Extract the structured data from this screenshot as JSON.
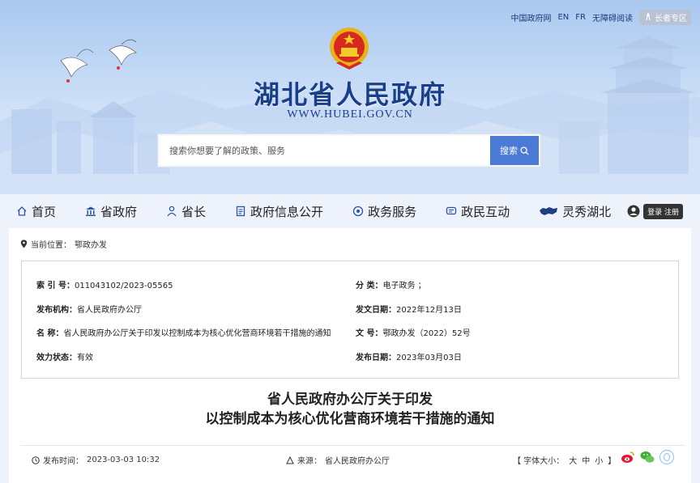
{
  "toplinks": {
    "gov_link": "中国政府网",
    "en": "EN",
    "fr": "FR",
    "accessible": "无障碍阅读",
    "elder": "长者专区"
  },
  "header": {
    "title": "湖北省人民政府",
    "url": "WWW.HUBEI.GOV.CN"
  },
  "search": {
    "placeholder": "搜索你想要了解的政策、服务",
    "button": "搜索"
  },
  "nav": {
    "items": [
      {
        "label": "首页",
        "icon": "home-icon"
      },
      {
        "label": "省政府",
        "icon": "building-icon"
      },
      {
        "label": "省长",
        "icon": "person-icon"
      },
      {
        "label": "政府信息公开",
        "icon": "document-icon"
      },
      {
        "label": "政务服务",
        "icon": "service-icon"
      },
      {
        "label": "政民互动",
        "icon": "chat-icon"
      },
      {
        "label": "灵秀湖北",
        "icon": "map-icon"
      }
    ],
    "login": "登录 注册"
  },
  "breadcrumb": {
    "label": "当前位置：",
    "current": "鄂政办发"
  },
  "meta": {
    "index_no_label": "索 引 号：",
    "index_no": "011043102/2023-05565",
    "category_label": "分    类：",
    "category": "电子政务   ；",
    "publisher_label": "发布机构：",
    "publisher": "省人民政府办公厅",
    "issue_date_label": "发文日期：",
    "issue_date": "2022年12月13日",
    "name_label": "名    称：",
    "name": "省人民政府办公厅关于印发以控制成本为核心优化营商环境若干措施的通知",
    "doc_no_label": "文    号：",
    "doc_no": "鄂政办发（2022）52号",
    "status_label": "效力状态：",
    "status": "有效",
    "release_date_label": "发布日期：",
    "release_date": "2023年03月03日"
  },
  "document": {
    "title_line1": "省人民政府办公厅关于印发",
    "title_line2": "以控制成本为核心优化营商环境若干措施的通知"
  },
  "info": {
    "pub_time_label": "发布时间：",
    "pub_time": "2023-03-03 10:32",
    "source_label": "来源：",
    "source": "省人民政府办公厅",
    "font_size_label": "【 字体大小：",
    "font_large": "大",
    "font_medium": "中",
    "font_small": "小",
    "font_close": "】"
  },
  "colors": {
    "brand_blue": "#1a3f8a",
    "search_button": "#4a79d6"
  }
}
